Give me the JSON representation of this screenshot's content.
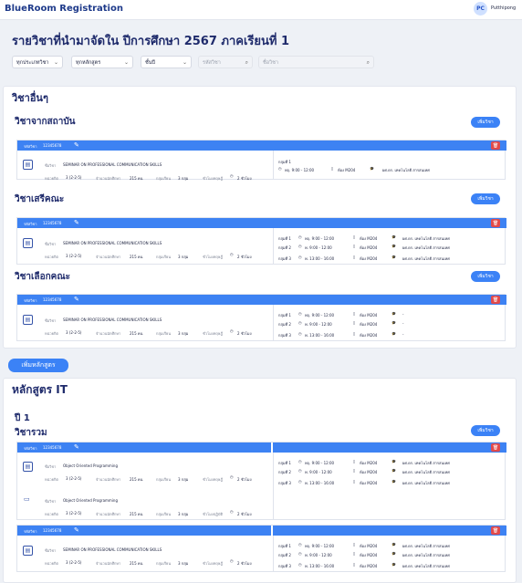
{
  "app": {
    "title": "BlueRoom Registration",
    "user_initials": "PC",
    "user_name": "Putthipong"
  },
  "page": {
    "title": "รายวิชาที่นำมาจัดใน ปีการศึกษา 2567 ภาคเรียนที่ 1"
  },
  "filters": {
    "type": "ทุกประเภทวิชา",
    "curriculum": "ทุกหลักสูตร",
    "year": "ชั้นปี",
    "search_code_placeholder": "รหัสวิชา",
    "search_name_placeholder": "ชื่อวิชา"
  },
  "labels": {
    "code": "รหัสวิชา",
    "course_name": "ชื่อวิชา",
    "credits": "หน่วยกิต",
    "students": "จำนวนนักศึกษา",
    "groups": "กลุ่มเรียน",
    "study_hours": "ชั่วโมงทฤษฎี",
    "practice_hours": "ชั่วโมงปฏิบัติ",
    "add_course": "เพิ่มวิชา",
    "add_curriculum": "เพิ่มหลักสูตร"
  },
  "sections": {
    "other": "วิชาอื่นๆ",
    "from_institute": "วิชาจากสถาบัน",
    "free_elective": "วิชาเสรีคณะ",
    "faculty_elective": "วิชาเลือกคณะ",
    "curriculum_it": "หลักสูตร IT",
    "year1": "ปี 1",
    "general": "วิชารวม"
  },
  "course": {
    "code": "12345678",
    "name": "SEMINAR ON PROFESSIONAL COMMUNICATION SKILLS",
    "name_oop": "Object Oriented Programming",
    "credits": "3 (2-2-5)",
    "students": "215 คน",
    "groups": "3 กลุ่ม",
    "hours": "2 ชั่วโมง"
  },
  "schedule": {
    "g1": "กลุ่มที่ 1",
    "g2": "กลุ่มที่ 2",
    "g3": "กลุ่มที่ 3",
    "time1": "พฤ. 9:00 - 12:00",
    "time2": "พ. 9:00 - 12:00",
    "time3": "พ. 13:00 - 16:00",
    "room": "ห้อง M204",
    "teacher": "ผศ.ดร. เทคโนโลยี สารสนเทศ",
    "dash": "-"
  }
}
